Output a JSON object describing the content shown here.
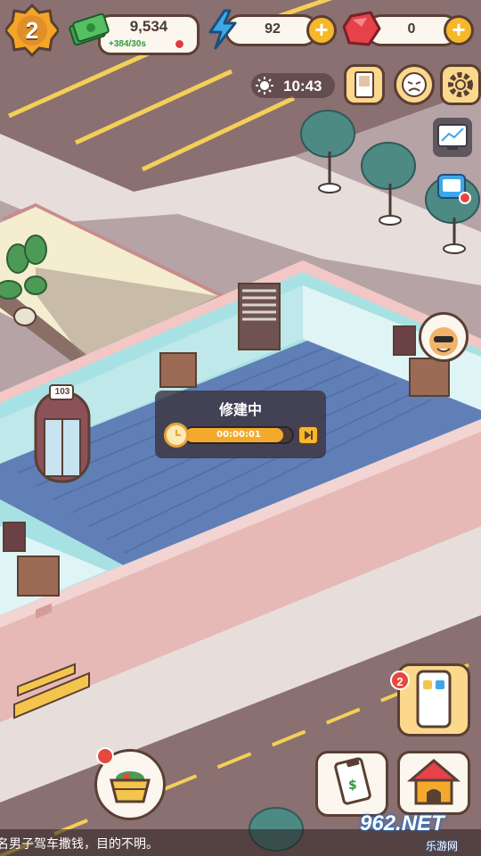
{
  "hud": {
    "level": "2",
    "cash": "9,534",
    "cash_rate": "+384/30s",
    "energy": "92",
    "gems": "0",
    "time": "10:43"
  },
  "construction": {
    "status_label": "修建中",
    "timer": "00:00:01",
    "progress": 0.92
  },
  "room": {
    "door_number": "103"
  },
  "phone": {
    "badge_count": "2"
  },
  "news_ticker": "名男子驾车撒钱，目的不明。",
  "watermark": {
    "logo": "962.NET",
    "sub": "乐游网"
  },
  "colors": {
    "accent": "#f7b72b",
    "panel_border": "#5a3f33",
    "floor": "#5f7fb6",
    "alert": "#e6473e"
  },
  "icons": [
    "cash-icon",
    "lightning-icon",
    "gem-icon",
    "sun-icon",
    "journal-icon",
    "face-icon",
    "gear-icon",
    "tv-icon",
    "alarm-icon",
    "clock-icon",
    "skip-icon",
    "basket-icon",
    "clipboard-icon",
    "doghouse-icon",
    "phone-icon",
    "visitor-avatar"
  ]
}
